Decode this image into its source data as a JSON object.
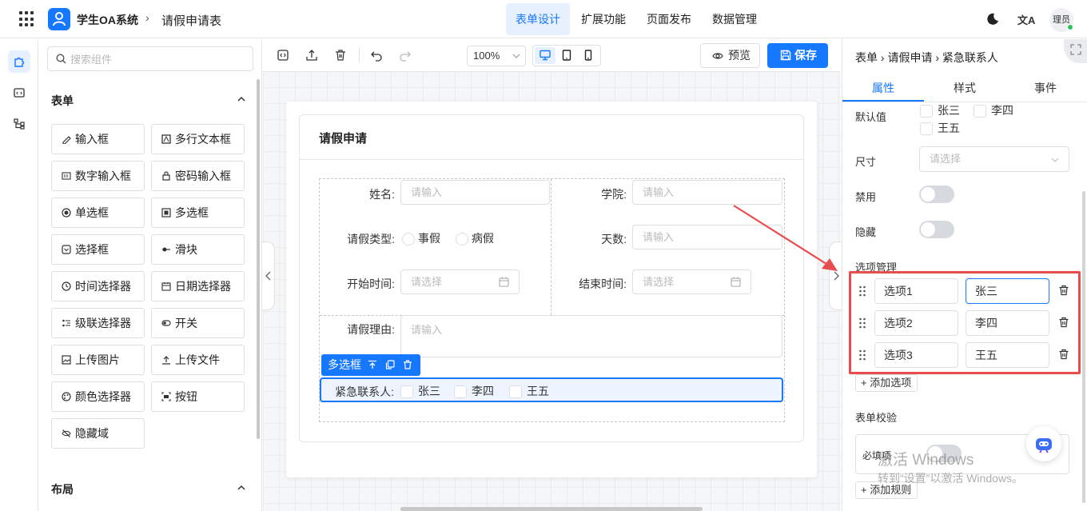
{
  "header": {
    "app_name": "学生OA系统",
    "separator": "›",
    "page_name": "请假申请表",
    "nav": [
      "表单设计",
      "扩展功能",
      "页面发布",
      "数据管理"
    ],
    "active_nav": 0,
    "translate_glyph": "文A",
    "user": "理员"
  },
  "components": {
    "search_placeholder": "搜索组件",
    "section_form": "表单",
    "section_layout": "布局",
    "items": [
      {
        "label": "输入框",
        "icon": "pencil-icon"
      },
      {
        "label": "多行文本框",
        "icon": "textarea-icon"
      },
      {
        "label": "数字输入框",
        "icon": "number-icon"
      },
      {
        "label": "密码输入框",
        "icon": "lock-icon"
      },
      {
        "label": "单选框",
        "icon": "radio-icon"
      },
      {
        "label": "多选框",
        "icon": "checkbox-icon"
      },
      {
        "label": "选择框",
        "icon": "select-icon"
      },
      {
        "label": "滑块",
        "icon": "slider-icon"
      },
      {
        "label": "时间选择器",
        "icon": "clock-icon"
      },
      {
        "label": "日期选择器",
        "icon": "calendar-icon"
      },
      {
        "label": "级联选择器",
        "icon": "cascader-icon"
      },
      {
        "label": "开关",
        "icon": "switch-icon"
      },
      {
        "label": "上传图片",
        "icon": "image-icon"
      },
      {
        "label": "上传文件",
        "icon": "upload-icon"
      },
      {
        "label": "颜色选择器",
        "icon": "palette-icon"
      },
      {
        "label": "按钮",
        "icon": "button-icon"
      },
      {
        "label": "隐藏域",
        "icon": "eye-off-icon"
      }
    ]
  },
  "toolbar": {
    "zoom": "100%",
    "preview": "预览",
    "save": "保存"
  },
  "form": {
    "title": "请假申请",
    "name_label": "姓名:",
    "name_placeholder": "请输入",
    "college_label": "学院:",
    "college_placeholder": "请输入",
    "leave_type_label": "请假类型:",
    "leave_type_options": [
      "事假",
      "病假"
    ],
    "days_label": "天数:",
    "days_placeholder": "请输入",
    "start_label": "开始时间:",
    "start_placeholder": "请选择",
    "end_label": "结束时间:",
    "end_placeholder": "请选择",
    "reason_label": "请假理由:",
    "reason_placeholder": "请输入",
    "selected_toolbar_label": "多选框",
    "contact_label": "紧急联系人:",
    "contact_options": [
      "张三",
      "李四",
      "王五"
    ]
  },
  "props": {
    "breadcrumb": "表单 › 请假申请 › 紧急联系人",
    "tabs": [
      "属性",
      "样式",
      "事件"
    ],
    "default_label": "默认值",
    "default_options": [
      "张三",
      "李四",
      "王五"
    ],
    "size_label": "尺寸",
    "size_placeholder": "请选择",
    "disabled_label": "禁用",
    "hidden_label": "隐藏",
    "options_label": "选项管理",
    "options": [
      {
        "label": "选项1",
        "value": "张三"
      },
      {
        "label": "选项2",
        "value": "李四"
      },
      {
        "label": "选项3",
        "value": "王五"
      }
    ],
    "add_option": "+ 添加选项",
    "validation_label": "表单校验",
    "required_label": "必填项",
    "add_rule": "+ 添加规则"
  },
  "watermark": {
    "line1": "激活 Windows",
    "line2": "转到“设置”以激活 Windows。"
  },
  "colors": {
    "accent": "#1677ff",
    "highlight_box": "#e84c4c"
  }
}
